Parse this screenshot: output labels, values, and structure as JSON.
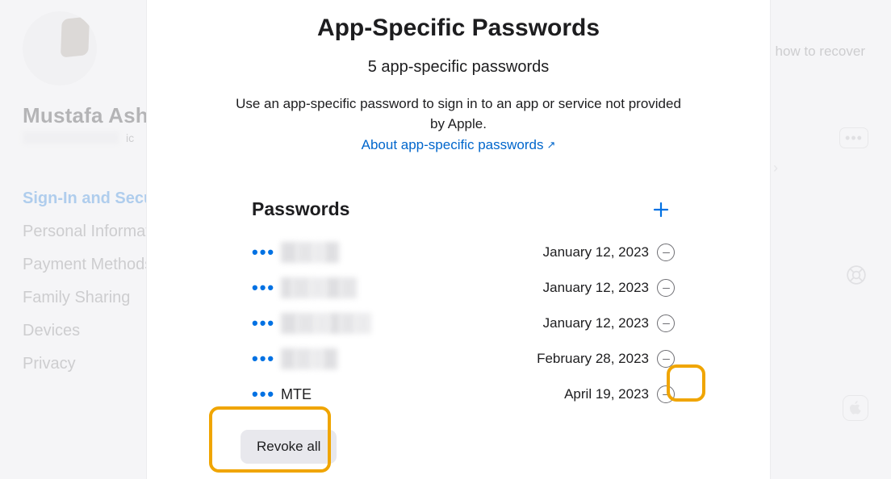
{
  "background": {
    "user_name": "Mustafa Ashour",
    "recover_hint": "how to recover",
    "nav": [
      {
        "label": "Sign-In and Security",
        "active": true
      },
      {
        "label": "Personal Information",
        "active": false
      },
      {
        "label": "Payment Methods",
        "active": false
      },
      {
        "label": "Family Sharing",
        "active": false
      },
      {
        "label": "Devices",
        "active": false
      },
      {
        "label": "Privacy",
        "active": false
      }
    ],
    "more_glyph": "•••"
  },
  "modal": {
    "title": "App-Specific Passwords",
    "subtitle": "5 app-specific passwords",
    "description": "Use an app-specific password to sign in to an app or service not provided by Apple.",
    "link_label": "About app-specific passwords",
    "link_arrow": "↗",
    "list_heading": "Passwords",
    "dots": "•••",
    "rows": [
      {
        "label": "",
        "redacted": true,
        "widths": [
          20,
          20,
          14,
          18
        ],
        "date": "January 12, 2023"
      },
      {
        "label": "",
        "redacted": true,
        "widths": [
          14,
          22,
          20,
          18,
          20
        ],
        "date": "January 12, 2023"
      },
      {
        "label": "",
        "redacted": true,
        "widths": [
          20,
          22,
          18,
          14,
          18,
          20
        ],
        "date": "January 12, 2023"
      },
      {
        "label": "",
        "redacted": true,
        "widths": [
          18,
          20,
          14,
          18
        ],
        "date": "February 28, 2023"
      },
      {
        "label": "MTE",
        "redacted": false,
        "date": "April 19, 2023"
      }
    ],
    "revoke_label": "Revoke all"
  },
  "colors": {
    "accent": "#0071e3",
    "highlight": "#f0a500"
  }
}
